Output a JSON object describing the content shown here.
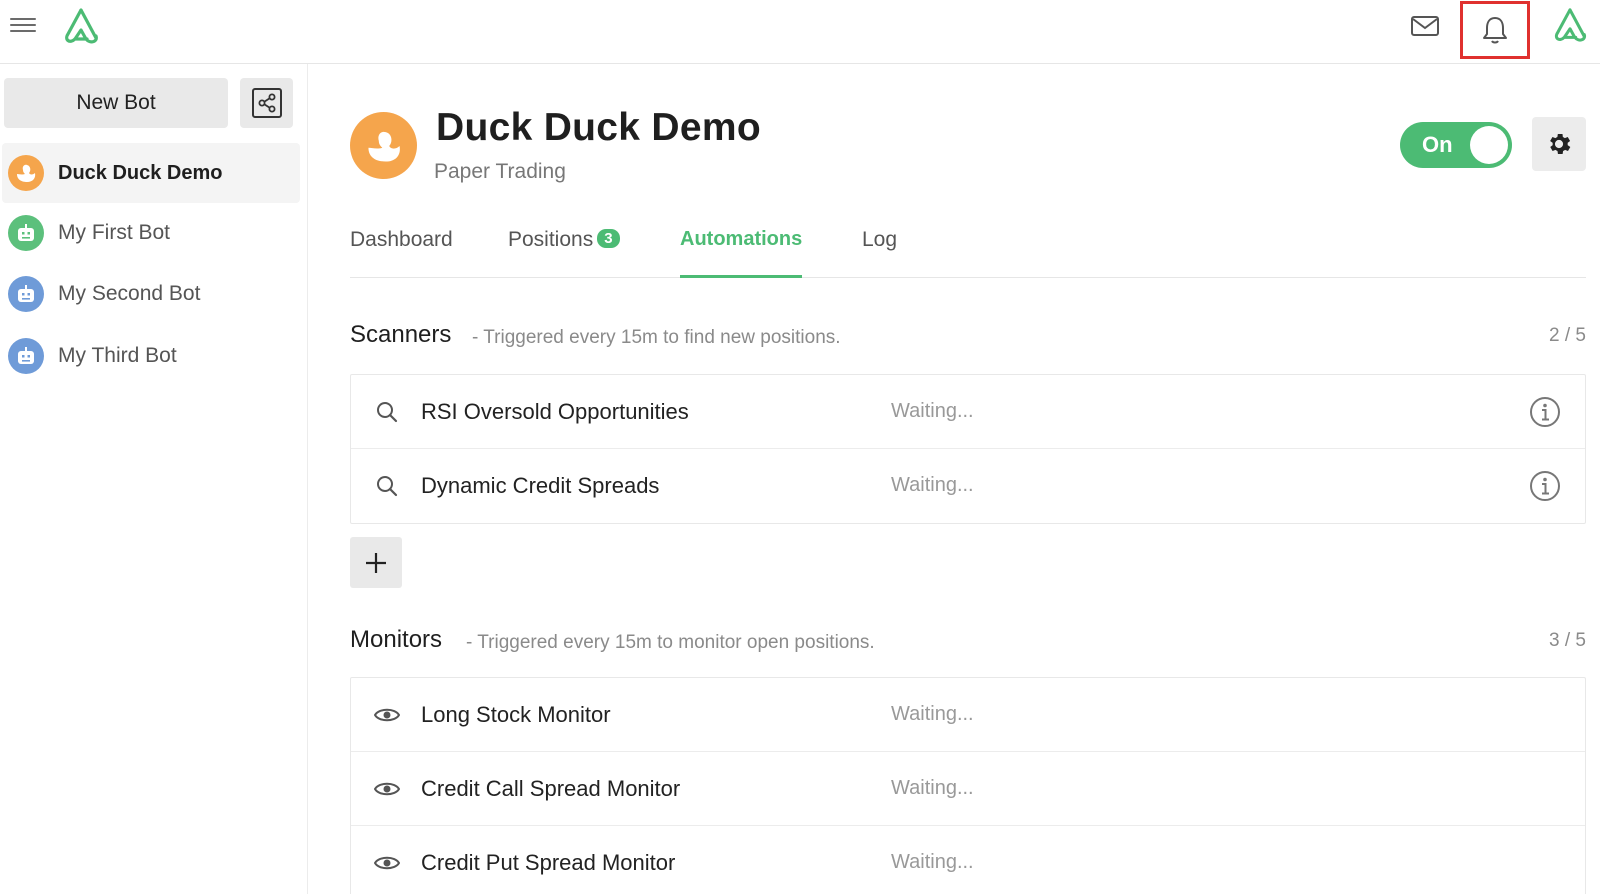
{
  "topbar": {
    "menu_icon": "hamburger-icon",
    "logo_icon": "brand-logo",
    "mail_icon": "envelope-icon",
    "bell_icon": "bell-icon",
    "highlight_color": "#e0312f"
  },
  "sidebar": {
    "new_bot_label": "New Bot",
    "share_icon": "share-icon",
    "bots": [
      {
        "label": "Duck Duck Demo",
        "avatar": "duck-avatar",
        "avatar_color": "#f5a54c",
        "active": true
      },
      {
        "label": "My First Bot",
        "avatar": "robot-avatar",
        "avatar_color": "#5cc07c",
        "active": false
      },
      {
        "label": "My Second Bot",
        "avatar": "robot-avatar",
        "avatar_color": "#6f9bd8",
        "active": false
      },
      {
        "label": "My Third Bot",
        "avatar": "robot-avatar",
        "avatar_color": "#6f9bd8",
        "active": false
      }
    ]
  },
  "header": {
    "title": "Duck Duck Demo",
    "subtitle": "Paper Trading",
    "toggle_label": "On",
    "toggle_on": true,
    "accent_color": "#4cbb74"
  },
  "tabs": [
    {
      "label": "Dashboard",
      "active": false
    },
    {
      "label": "Positions",
      "badge": "3",
      "active": false
    },
    {
      "label": "Automations",
      "active": true
    },
    {
      "label": "Log",
      "active": false
    }
  ],
  "scanners": {
    "title": "Scanners",
    "description": "- Triggered every 15m to find new positions.",
    "count": "2 / 5",
    "items": [
      {
        "name": "RSI Oversold Opportunities",
        "status": "Waiting...",
        "icon": "search-icon"
      },
      {
        "name": "Dynamic Credit Spreads",
        "status": "Waiting...",
        "icon": "search-icon"
      }
    ],
    "add_icon": "plus-icon"
  },
  "monitors": {
    "title": "Monitors",
    "description": "- Triggered every 15m to monitor open positions.",
    "count": "3 / 5",
    "items": [
      {
        "name": "Long Stock Monitor",
        "status": "Waiting...",
        "icon": "eye-icon"
      },
      {
        "name": "Credit Call Spread Monitor",
        "status": "Waiting...",
        "icon": "eye-icon"
      },
      {
        "name": "Credit Put Spread Monitor",
        "status": "Waiting...",
        "icon": "eye-icon"
      }
    ]
  }
}
